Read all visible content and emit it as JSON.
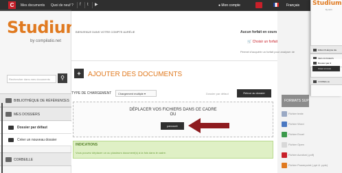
{
  "topbar": {
    "logo_letter": "C",
    "nav": [
      "Mes documents",
      "Quoi de neuf ?"
    ],
    "social_icons": [
      "facebook-icon",
      "twitter-icon",
      "youtube-icon"
    ],
    "account_label": "Mon compte",
    "language": "Français"
  },
  "sidebar": {
    "logo": "Studium",
    "logo_sub": "by compilatio.net",
    "search_placeholder": "Rechercher dans mes documents",
    "library": "BIBLIOTHÈQUE DE RÉFÉRENCES",
    "folders": "MES DOSSIERS",
    "default_folder": "Dossier par défaut",
    "create_folder": "Créer un nouveau dossier",
    "trash": "CORBEILLE"
  },
  "header": {
    "welcome": "BIENVENUE DANS VOTRE COMPTE AURÉLIE",
    "forfait_title": "Aucun forfait en cours",
    "forfait_link": "Choisir un forfait",
    "forfait_note": "Permet d'acquérir un forfait pour analyser de"
  },
  "main": {
    "title": "AJOUTER DES DOCUMENTS",
    "charge_label": "TYPE DE CHARGEMENT",
    "charge_value": "Chargement multiple ▾",
    "default_folder": "Dossier par défaut",
    "back_button": "Retour au dossier",
    "drop_line1": "DÉPLACER VOS FICHIERS DANS CE CADRE",
    "drop_line2": "OU",
    "browse_button": "parcourir",
    "ind_title": "INDICATIONS",
    "ind_text": "Vous pouvez déplacer un ou plusieurs document(s) à la fois dans le cadre."
  },
  "formats": {
    "title": "FORMATS SUPPORTÉS",
    "items": [
      {
        "label": "Fichier texte",
        "color": "#9aa9c4"
      },
      {
        "label": "Fichier Word",
        "color": "#4a78c2"
      },
      {
        "label": "Fichier Excel",
        "color": "#3c9a4c"
      },
      {
        "label": "Fichier Open",
        "color": "#d8d8d8"
      },
      {
        "label": "Fichier Acrobat (.pdf)",
        "color": "#c8202a"
      },
      {
        "label": "Fichier Powerpoint (.ppt & .pptx)",
        "color": "#e07a20"
      }
    ]
  },
  "overlay": {
    "logo": "Studium",
    "logo_sub": "by com",
    "library": "BIBLIOTHÈQUE DE",
    "folders": "MES DOSSIERS",
    "default_folder": "Dossier par d",
    "create_folder": "Créer un nouv",
    "trash": "CORBEILLE"
  },
  "colors": {
    "brand_orange": "#e07a20",
    "brand_red": "#c8202a",
    "arrow": "#8e1b1f",
    "dark": "#2f2f2f"
  }
}
